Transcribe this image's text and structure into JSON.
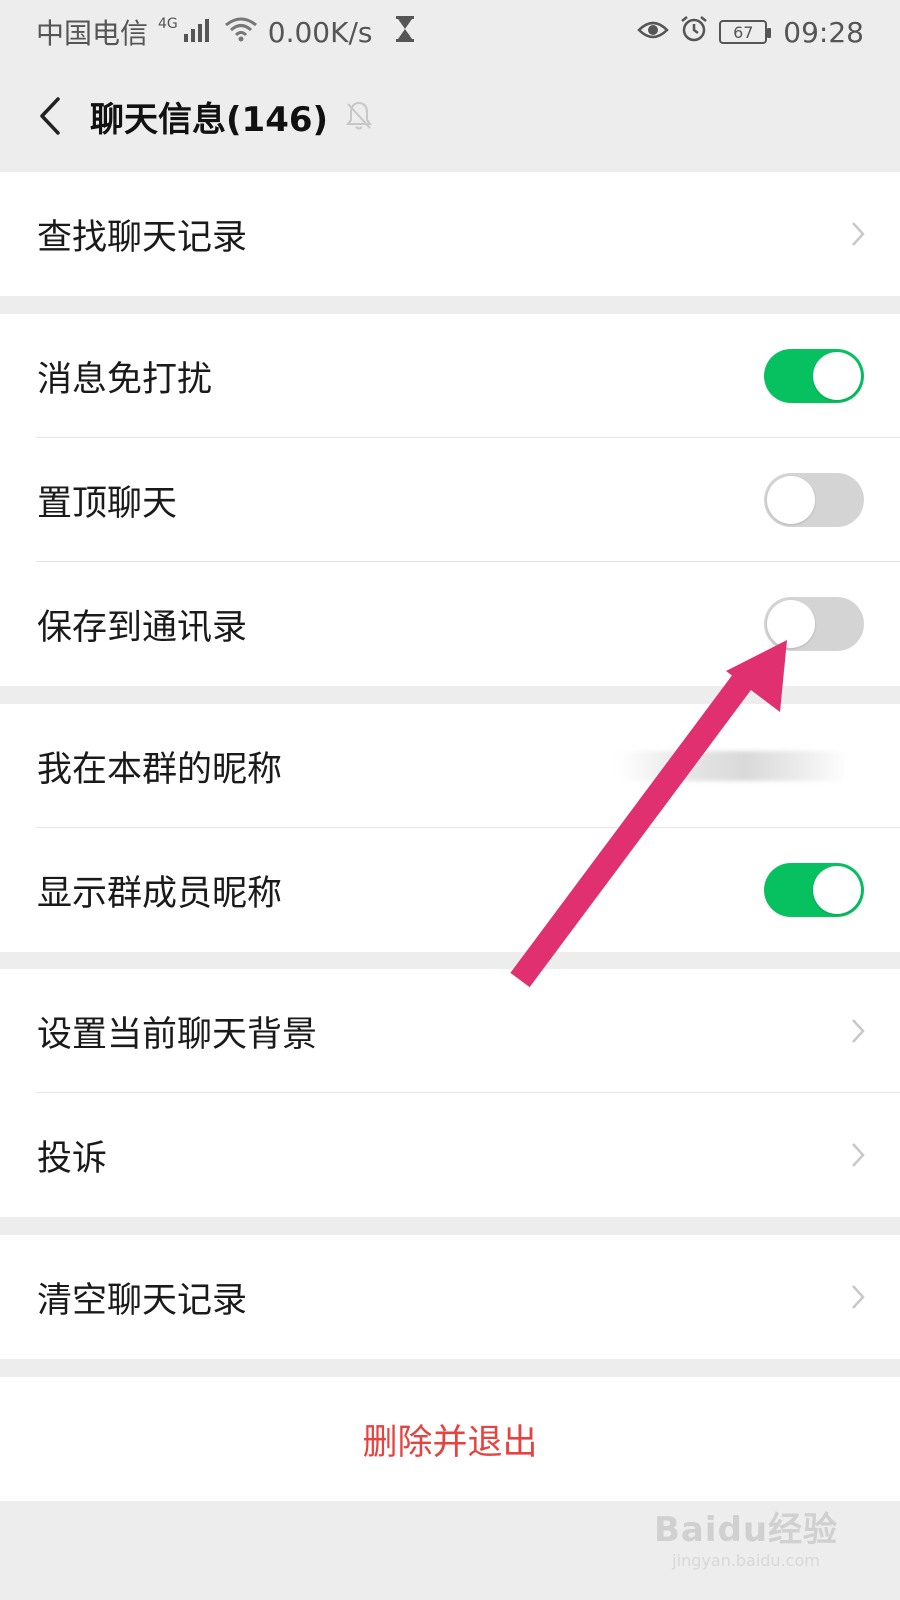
{
  "status_bar": {
    "carrier": "中国电信",
    "network_type": "4G",
    "speed": "0.00K/s",
    "battery": "67",
    "time": "09:28",
    "icons": [
      "signal-icon",
      "wifi-icon",
      "hourglass-icon",
      "eye-icon",
      "alarm-icon",
      "battery-icon"
    ]
  },
  "header": {
    "title": "聊天信息(146)",
    "back_icon": "back-arrow-icon",
    "mute_icon": "bell-off-icon"
  },
  "groups": [
    {
      "items": [
        {
          "label": "查找聊天记录",
          "control": "chevron"
        }
      ]
    },
    {
      "items": [
        {
          "label": "消息免打扰",
          "control": "toggle",
          "on": true
        },
        {
          "label": "置顶聊天",
          "control": "toggle",
          "on": false
        },
        {
          "label": "保存到通讯录",
          "control": "toggle",
          "on": false
        }
      ]
    },
    {
      "items": [
        {
          "label": "我在本群的昵称",
          "control": "chevron",
          "value": ""
        },
        {
          "label": "显示群成员昵称",
          "control": "toggle",
          "on": true
        }
      ]
    },
    {
      "items": [
        {
          "label": "设置当前聊天背景",
          "control": "chevron"
        },
        {
          "label": "投诉",
          "control": "chevron"
        }
      ]
    },
    {
      "items": [
        {
          "label": "清空聊天记录",
          "control": "chevron"
        }
      ]
    }
  ],
  "delete_exit": {
    "label": "删除并退出"
  },
  "colors": {
    "toggle_on": "#07c160",
    "toggle_off": "#d4d4d4",
    "danger": "#e64340",
    "annotation_arrow": "#e0306f",
    "page_bg": "#ededed"
  },
  "watermark": {
    "logo": "Baidu经验",
    "url": "jingyan.baidu.com"
  }
}
